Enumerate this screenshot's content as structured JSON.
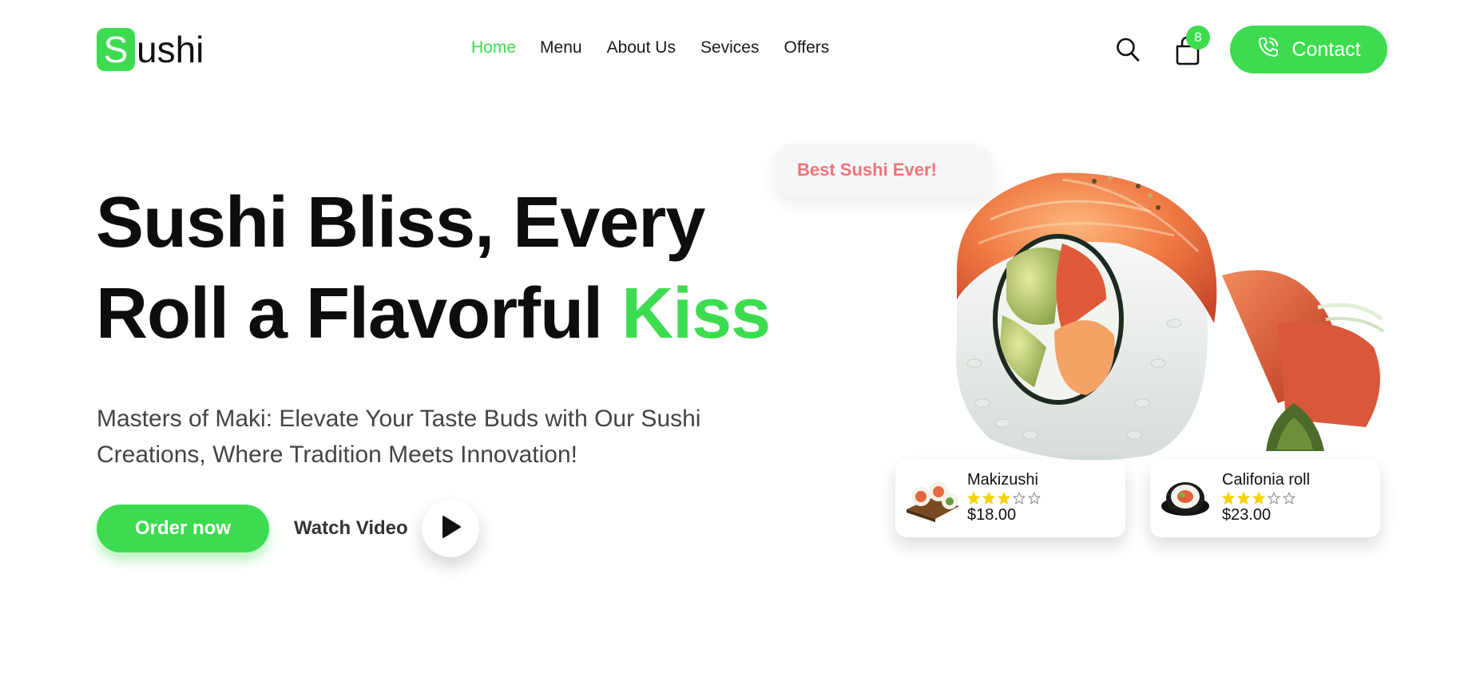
{
  "brand": {
    "logo_letter": "S",
    "logo_rest": "ushi"
  },
  "nav": {
    "items": [
      {
        "label": "Home",
        "active": true
      },
      {
        "label": "Menu"
      },
      {
        "label": "About Us"
      },
      {
        "label": "Sevices"
      },
      {
        "label": "Offers"
      }
    ]
  },
  "header": {
    "search_icon": "search-icon",
    "cart_icon": "shopping-bag-icon",
    "cart_count": "8",
    "contact_label": "Contact",
    "contact_icon": "phone-icon"
  },
  "hero": {
    "title_line1": "Sushi Bliss, Every",
    "title_line2_main": "Roll a Flavorful ",
    "title_line2_accent": "Kiss",
    "subtitle": "Masters of Maki: Elevate Your Taste Buds with Our Sushi Creations, Where Tradition Meets Innovation!",
    "order_label": "Order now",
    "watch_label": "Watch Video",
    "play_icon": "play-icon"
  },
  "bubble": {
    "text": "Best Sushi Ever!"
  },
  "products": [
    {
      "name": "Makizushi",
      "rating": 3,
      "max_rating": 5,
      "price": "$18.00"
    },
    {
      "name": "Califonia roll",
      "rating": 3,
      "max_rating": 5,
      "price": "$23.00"
    }
  ],
  "colors": {
    "accent": "#3ddc50",
    "bubble_text": "#f2737a",
    "star": "#f5d20a"
  }
}
